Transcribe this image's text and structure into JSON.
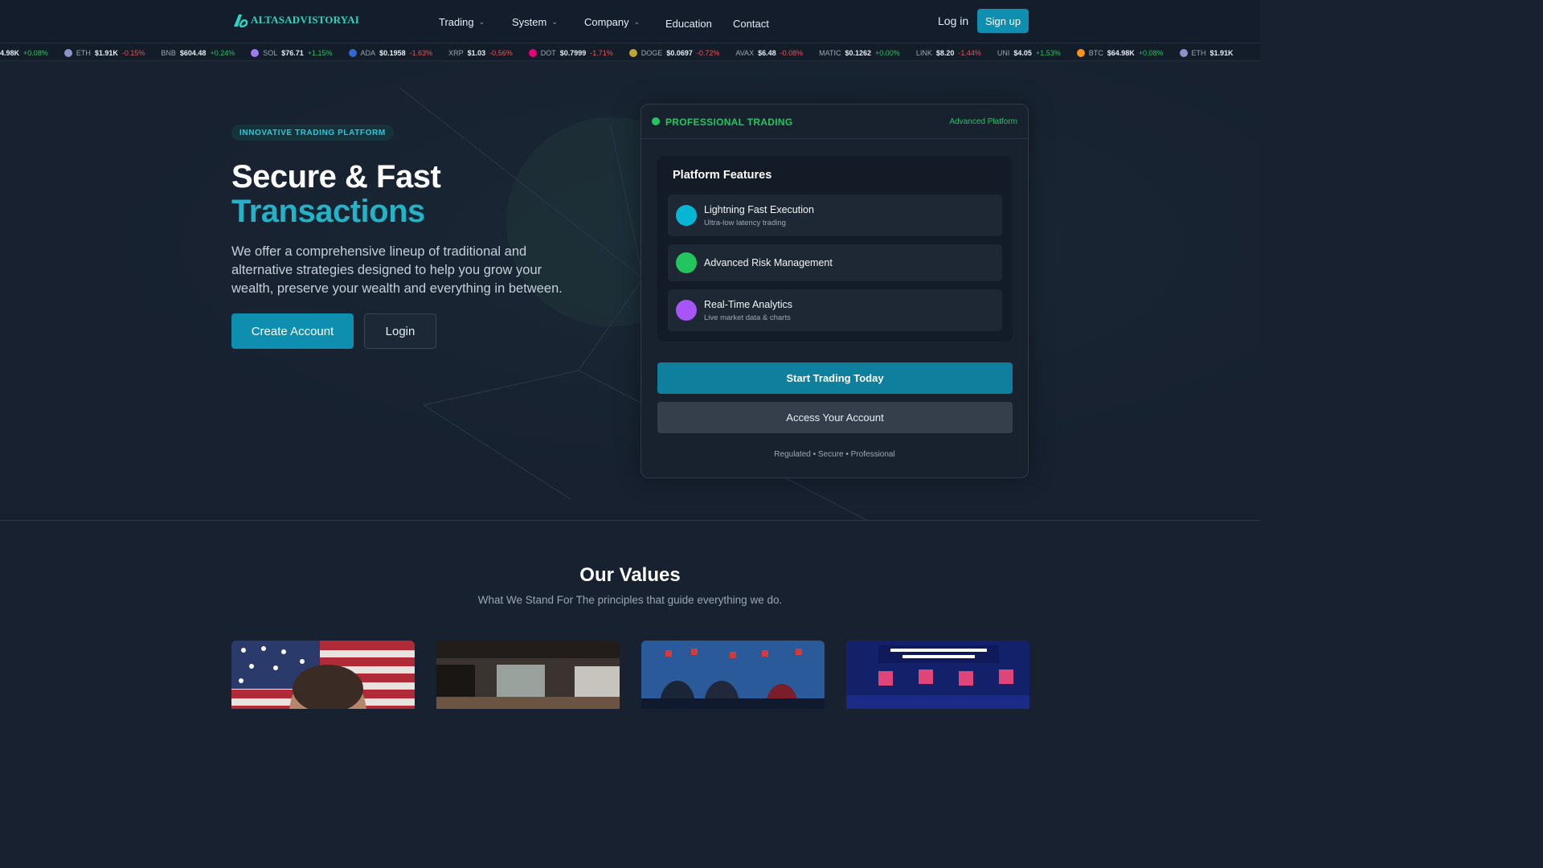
{
  "brand": {
    "name": "ALTASADVISTORYAI"
  },
  "nav": {
    "items": [
      {
        "label": "Trading",
        "has_dropdown": true
      },
      {
        "label": "System",
        "has_dropdown": true
      },
      {
        "label": "Company",
        "has_dropdown": true
      },
      {
        "label": "Education",
        "has_dropdown": false
      },
      {
        "label": "Contact",
        "has_dropdown": false
      }
    ],
    "login": "Log in",
    "signup": "Sign up"
  },
  "ticker": [
    {
      "symbol": "",
      "price": "4.98K",
      "change": "+0.08%",
      "dir": "up",
      "icon": "none"
    },
    {
      "symbol": "ETH",
      "price": "$1.91K",
      "change": "-0.15%",
      "dir": "down",
      "icon": "eth-icon"
    },
    {
      "symbol": "BNB",
      "price": "$604.48",
      "change": "+0.24%",
      "dir": "up",
      "icon": "none"
    },
    {
      "symbol": "SOL",
      "price": "$76.71",
      "change": "+1.15%",
      "dir": "up",
      "icon": "sol-icon"
    },
    {
      "symbol": "ADA",
      "price": "$0.1958",
      "change": "-1.63%",
      "dir": "down",
      "icon": "ada-icon"
    },
    {
      "symbol": "XRP",
      "price": "$1.03",
      "change": "-0.56%",
      "dir": "down",
      "icon": "none"
    },
    {
      "symbol": "DOT",
      "price": "$0.7999",
      "change": "-1.71%",
      "dir": "down",
      "icon": "dot-icon"
    },
    {
      "symbol": "DOGE",
      "price": "$0.0697",
      "change": "-0.72%",
      "dir": "down",
      "icon": "doge-icon"
    },
    {
      "symbol": "AVAX",
      "price": "$6.48",
      "change": "-0.08%",
      "dir": "down",
      "icon": "none"
    },
    {
      "symbol": "MATIC",
      "price": "$0.1262",
      "change": "+0.00%",
      "dir": "up",
      "icon": "none"
    },
    {
      "symbol": "LINK",
      "price": "$8.20",
      "change": "-1.44%",
      "dir": "down",
      "icon": "none"
    },
    {
      "symbol": "UNI",
      "price": "$4.05",
      "change": "+1.53%",
      "dir": "up",
      "icon": "none"
    },
    {
      "symbol": "BTC",
      "price": "$64.98K",
      "change": "+0.08%",
      "dir": "up",
      "icon": "btc-icon"
    },
    {
      "symbol": "ETH",
      "price": "$1.91K",
      "change": "",
      "dir": "down",
      "icon": "eth-icon"
    }
  ],
  "hero": {
    "tag": "INNOVATIVE TRADING PLATFORM",
    "title_line1": "Secure & Fast",
    "title_line2": "Transactions",
    "lead": "We offer a comprehensive lineup of traditional and alternative strategies designed to help you grow your wealth, preserve your wealth and everything in between.",
    "primary_cta": "Create Account",
    "secondary_cta": "Login"
  },
  "card": {
    "title": "PROFESSIONAL TRADING",
    "badge": "Advanced Platform",
    "features_title": "Platform Features",
    "features": [
      {
        "title": "Lightning Fast Execution",
        "subtitle": "Ultra-low latency trading",
        "color": "#06b6d4"
      },
      {
        "title": "Advanced Risk Management",
        "subtitle": "",
        "color": "#22c55e"
      },
      {
        "title": "Real-Time Analytics",
        "subtitle": "Live market data & charts",
        "color": "#a855f7"
      }
    ],
    "cta_primary": "Start Trading Today",
    "cta_secondary": "Access Your Account",
    "footer": "Regulated • Secure • Professional"
  },
  "values": {
    "title": "Our Values",
    "subtitle": "What We Stand For The principles that guide everything we do."
  },
  "colors": {
    "accent": "#0e8fb0",
    "teal_text": "#22b3c8",
    "green": "#22c55e",
    "red": "#f05252",
    "bg": "#172130"
  }
}
